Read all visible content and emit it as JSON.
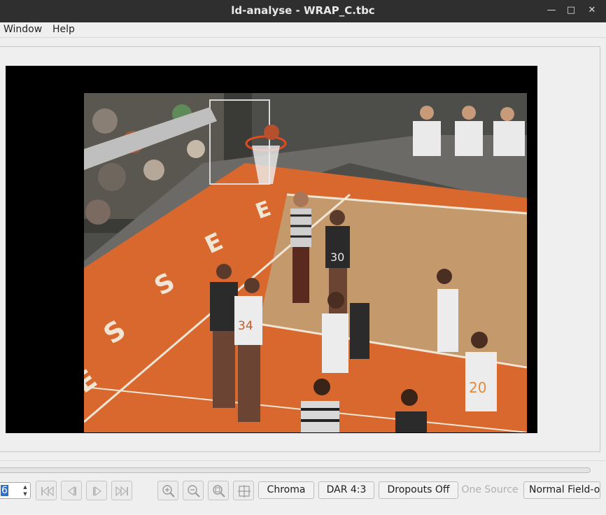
{
  "window": {
    "title": "ld-analyse - WRAP_C.tbc",
    "minimize_icon": "minimize-icon",
    "maximize_icon": "maximize-icon",
    "close_icon": "close-icon"
  },
  "menu": {
    "items": [
      "Window",
      "Help"
    ]
  },
  "viewer": {
    "frame_content": "basketball game video frame"
  },
  "toolbar": {
    "frame_number": "6",
    "icons": [
      "first-frame-icon",
      "previous-frame-icon",
      "next-frame-icon",
      "last-frame-icon",
      "zoom-in-icon",
      "zoom-out-icon",
      "zoom-fit-icon",
      "crosshair-icon"
    ],
    "chroma_label": "Chroma",
    "dar_label": "DAR 4:3",
    "dropouts_label": "Dropouts Off",
    "source_label": "One Source",
    "field_order_label": "Normal Field-o"
  },
  "colors": {
    "titlebar": "#2f2f2f",
    "court_orange": "#d9682e",
    "court_wood": "#c49a6c"
  }
}
